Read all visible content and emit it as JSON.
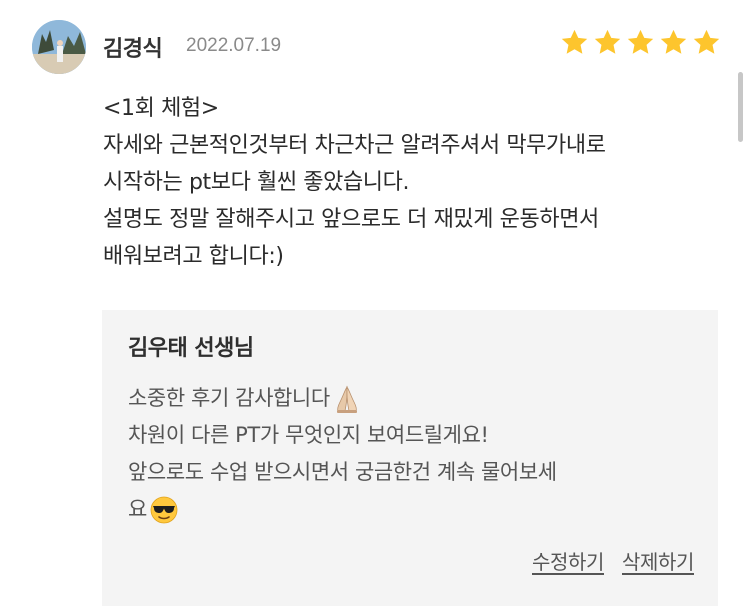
{
  "review": {
    "reviewer_name": "김경식",
    "date": "2022.07.19",
    "rating": 5,
    "star_color": "#FDC52D",
    "lines": [
      "<1회 체험>",
      "자세와 근본적인것부터 차근차근 알려주셔서 막무가내로",
      "시작하는 pt보다 훨씬 좋았습니다.",
      "설명도 정말 잘해주시고 앞으로도 더 재밌게 운동하면서",
      "배워보려고 합니다:)"
    ]
  },
  "reply": {
    "author": "김우태 선생님",
    "line1": "소중한 후기 감사합니다",
    "line1_emoji": "folded-hands-icon",
    "line2": "차원이 다른 PT가 무엇인지 보여드릴게요!",
    "line3": "앞으로도 수업 받으시면서 궁금한건 계속 물어보세",
    "line4": "요",
    "line4_emoji": "sunglasses-face-icon",
    "background": "#F4F4F4"
  },
  "actions": {
    "edit_label": "수정하기",
    "delete_label": "삭제하기"
  }
}
